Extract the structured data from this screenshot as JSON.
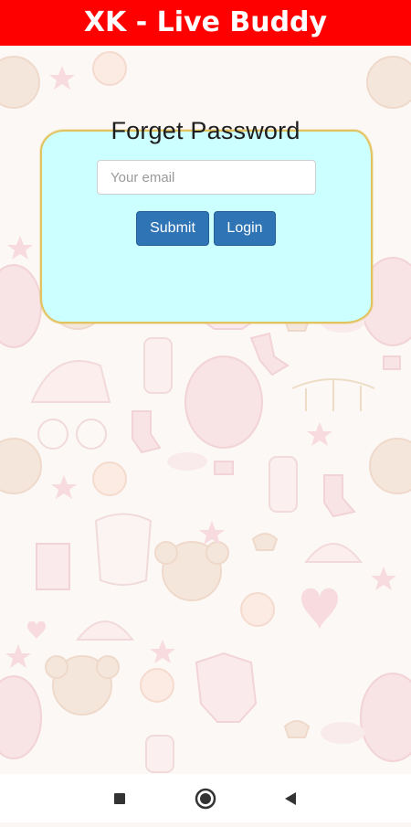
{
  "app": {
    "title": "XK - Live Buddy"
  },
  "form": {
    "title": "Forget Password",
    "email_placeholder": "Your email",
    "email_value": "",
    "submit_label": "Submit",
    "login_label": "Login"
  },
  "navbar": {
    "buttons": [
      {
        "icon": "square-recents-icon"
      },
      {
        "icon": "circle-home-icon"
      },
      {
        "icon": "triangle-back-icon"
      }
    ]
  },
  "colors": {
    "titlebar": "#ff0000",
    "card": "#ccffff",
    "card_border": "#e2c35f",
    "button": "#2f74b5"
  }
}
